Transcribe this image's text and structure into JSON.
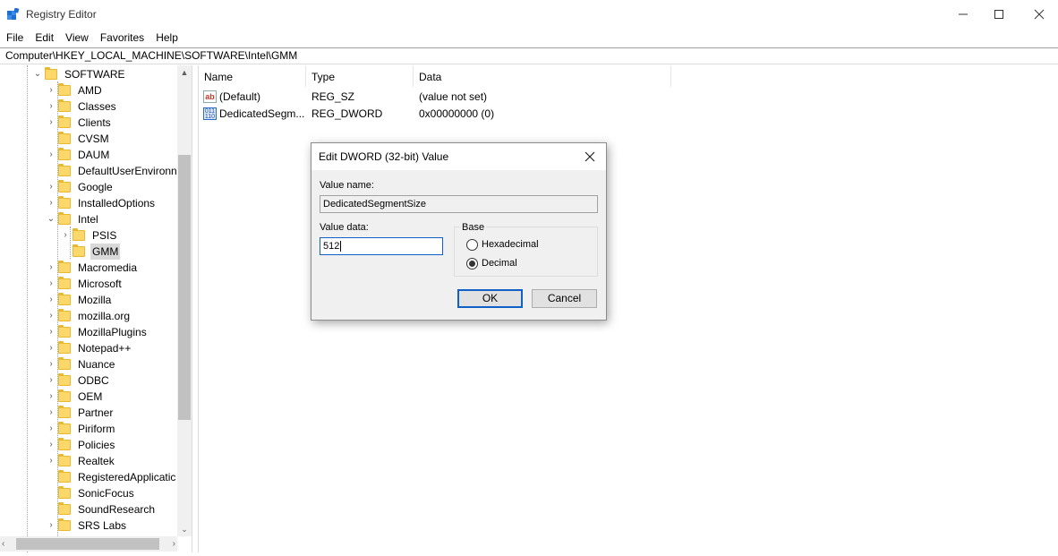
{
  "window": {
    "title": "Registry Editor",
    "minimize_glyph": "—",
    "maximize_glyph": "☐",
    "close_glyph": "✕"
  },
  "menu": [
    "File",
    "Edit",
    "View",
    "Favorites",
    "Help"
  ],
  "address": "Computer\\HKEY_LOCAL_MACHINE\\SOFTWARE\\Intel\\GMM",
  "tree": {
    "root": "SOFTWARE",
    "items": [
      {
        "label": "AMD",
        "expandable": true
      },
      {
        "label": "Classes",
        "expandable": true
      },
      {
        "label": "Clients",
        "expandable": true
      },
      {
        "label": "CVSM",
        "expandable": false
      },
      {
        "label": "DAUM",
        "expandable": true
      },
      {
        "label": "DefaultUserEnvironn",
        "expandable": false
      },
      {
        "label": "Google",
        "expandable": true
      },
      {
        "label": "InstalledOptions",
        "expandable": true
      },
      {
        "label": "Intel",
        "expandable": true,
        "expanded": true
      },
      {
        "label": "PSIS",
        "expandable": true,
        "child": true
      },
      {
        "label": "GMM",
        "expandable": false,
        "child": true,
        "selected": true
      },
      {
        "label": "Macromedia",
        "expandable": true
      },
      {
        "label": "Microsoft",
        "expandable": true
      },
      {
        "label": "Mozilla",
        "expandable": true
      },
      {
        "label": "mozilla.org",
        "expandable": true
      },
      {
        "label": "MozillaPlugins",
        "expandable": true
      },
      {
        "label": "Notepad++",
        "expandable": true
      },
      {
        "label": "Nuance",
        "expandable": true
      },
      {
        "label": "ODBC",
        "expandable": true
      },
      {
        "label": "OEM",
        "expandable": true
      },
      {
        "label": "Partner",
        "expandable": true
      },
      {
        "label": "Piriform",
        "expandable": true
      },
      {
        "label": "Policies",
        "expandable": true
      },
      {
        "label": "Realtek",
        "expandable": true
      },
      {
        "label": "RegisteredApplicatic",
        "expandable": false
      },
      {
        "label": "SonicFocus",
        "expandable": false
      },
      {
        "label": "SoundResearch",
        "expandable": false
      },
      {
        "label": "SRS Labs",
        "expandable": true
      }
    ]
  },
  "list": {
    "columns": [
      "Name",
      "Type",
      "Data"
    ],
    "rows": [
      {
        "icon": "string-value-icon",
        "icon_text": "ab",
        "name": "(Default)",
        "type": "REG_SZ",
        "data": "(value not set)"
      },
      {
        "icon": "binary-value-icon",
        "icon_text": "011\n110",
        "name": "DedicatedSegm...",
        "type": "REG_DWORD",
        "data": "0x00000000 (0)"
      }
    ]
  },
  "dialog": {
    "title": "Edit DWORD (32-bit) Value",
    "value_name_label": "Value name:",
    "value_name": "DedicatedSegmentSize",
    "value_data_label": "Value data:",
    "value_data": "512",
    "base_label": "Base",
    "base_options": [
      {
        "label": "Hexadecimal",
        "selected": false
      },
      {
        "label": "Decimal",
        "selected": true
      }
    ],
    "ok_label": "OK",
    "cancel_label": "Cancel"
  }
}
